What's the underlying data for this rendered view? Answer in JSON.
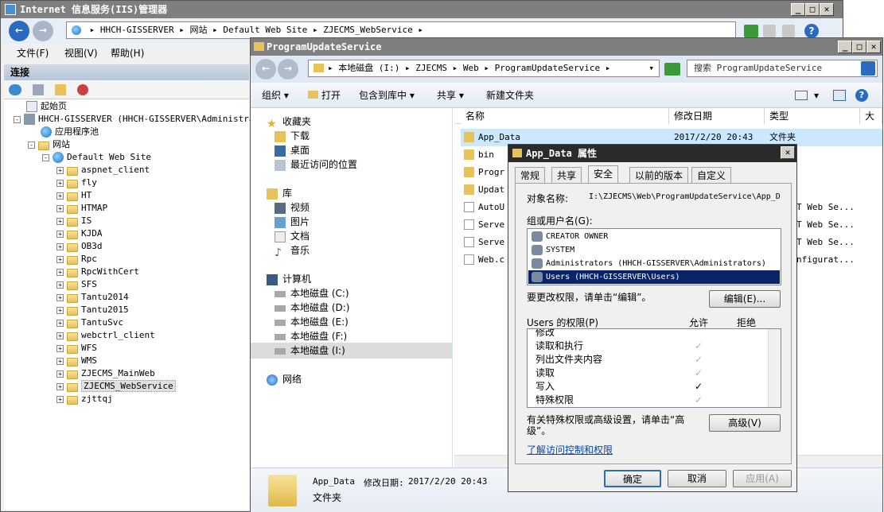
{
  "iis": {
    "title": "Internet 信息服务(IIS)管理器",
    "address": [
      "HHCH-GISSERVER",
      "网站",
      "Default Web Site",
      "ZJECMS_WebService"
    ],
    "menu": [
      "文件(F)",
      "视图(V)",
      "帮助(H)"
    ],
    "connections_header": "连接",
    "tree": {
      "start_page": "起始页",
      "server": "HHCH-GISSERVER (HHCH-GISSERVER\\Administrator",
      "app_pools": "应用程序池",
      "sites": "网站",
      "default_site": "Default Web Site",
      "children": [
        "aspnet_client",
        "fly",
        "HT",
        "HTMAP",
        "IS",
        "KJDA",
        "OB3d",
        "Rpc",
        "RpcWithCert",
        "SFS",
        "Tantu2014",
        "Tantu2015",
        "TantuSvc",
        "webctrl_client",
        "WFS",
        "WMS",
        "ZJECMS_MainWeb",
        "ZJECMS_WebService",
        "zjttqj"
      ]
    }
  },
  "explorer": {
    "title": "ProgramUpdateService",
    "breadcrumb": [
      "本地磁盘 (I:)",
      "ZJECMS",
      "Web",
      "ProgramUpdateService"
    ],
    "search_placeholder": "搜索 ProgramUpdateService",
    "toolbar": [
      "组织",
      "打开",
      "包含到库中",
      "共享",
      "新建文件夹"
    ],
    "nav": {
      "favorites": "收藏夹",
      "fav_items": [
        "下载",
        "桌面",
        "最近访问的位置"
      ],
      "libraries": "库",
      "lib_items": [
        "视频",
        "图片",
        "文档",
        "音乐"
      ],
      "computer": "计算机",
      "drives": [
        "本地磁盘 (C:)",
        "本地磁盘 (D:)",
        "本地磁盘 (E:)",
        "本地磁盘 (F:)",
        "本地磁盘 (I:)"
      ],
      "network": "网络"
    },
    "columns": [
      "名称",
      "修改日期",
      "类型",
      "大小"
    ],
    "files": [
      {
        "name": "App_Data",
        "date": "2017/2/20 20:43",
        "type": "文件夹"
      },
      {
        "name": "bin",
        "date": "",
        "type": ""
      },
      {
        "name": "Progr",
        "date": "",
        "type": ""
      },
      {
        "name": "Updat",
        "date": "",
        "type": ""
      },
      {
        "name": "AutoU",
        "date": "",
        "type": "T Web Se..."
      },
      {
        "name": "Serve",
        "date": "",
        "type": "T Web Se..."
      },
      {
        "name": "Serve",
        "date": "",
        "type": "T Web Se..."
      },
      {
        "name": "Web.c",
        "date": "",
        "type": "nfigurat..."
      }
    ],
    "details": {
      "name": "App_Data",
      "modified_label": "修改日期:",
      "modified": "2017/2/20 20:43",
      "type": "文件夹"
    }
  },
  "dialog": {
    "title": "App_Data 属性",
    "tabs": [
      "常规",
      "共享",
      "安全",
      "以前的版本",
      "自定义"
    ],
    "active_tab": "安全",
    "object_label": "对象名称:",
    "object_value": "I:\\ZJECMS\\Web\\ProgramUpdateService\\App_D",
    "group_label": "组或用户名(G):",
    "users": [
      "CREATOR OWNER",
      "SYSTEM",
      "Administrators (HHCH-GISSERVER\\Administrators)",
      "Users (HHCH-GISSERVER\\Users)"
    ],
    "edit_hint": "要更改权限，请单击“编辑”。",
    "edit_button": "编辑(E)...",
    "perm_label": "Users 的权限(P)",
    "allow": "允许",
    "deny": "拒绝",
    "permissions": [
      {
        "name": "修改",
        "allow": ""
      },
      {
        "name": "读取和执行",
        "allow": "✓"
      },
      {
        "name": "列出文件夹内容",
        "allow": "✓"
      },
      {
        "name": "读取",
        "allow": "✓"
      },
      {
        "name": "写入",
        "allow": "✓"
      },
      {
        "name": "特殊权限",
        "allow": "✓"
      }
    ],
    "adv_hint": "有关特殊权限或高级设置，请单击“高级”。",
    "adv_button": "高级(V)",
    "link": "了解访问控制和权限",
    "ok": "确定",
    "cancel": "取消",
    "apply": "应用(A)"
  }
}
